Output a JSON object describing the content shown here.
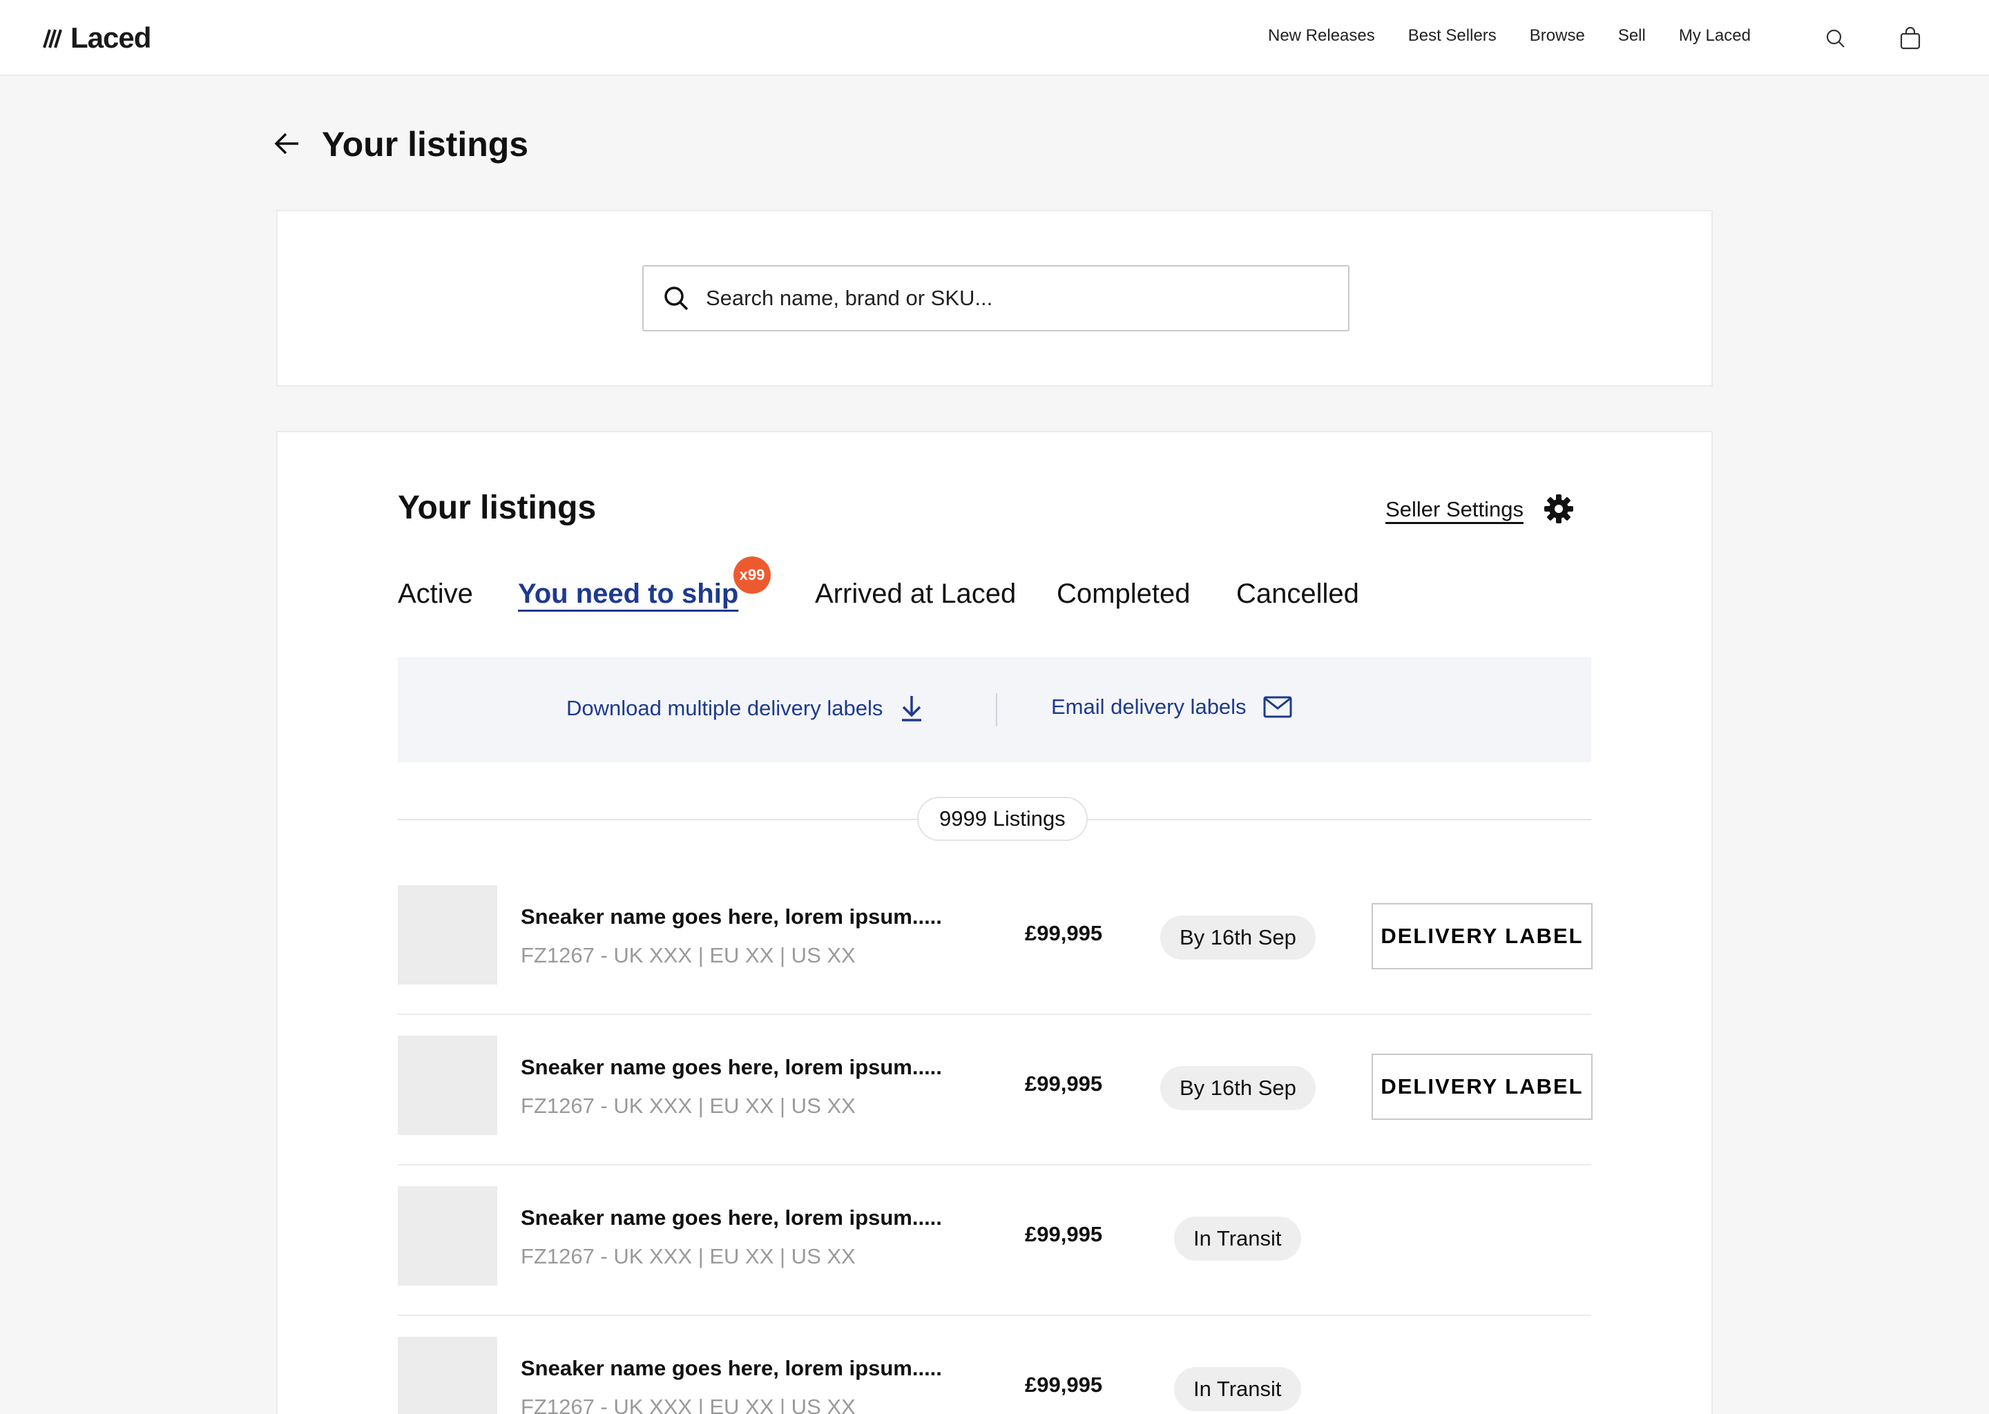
{
  "header": {
    "logo_text": "Laced",
    "nav": [
      "New Releases",
      "Best Sellers",
      "Browse",
      "Sell",
      "My Laced"
    ],
    "icons": [
      "search-icon",
      "bag-icon"
    ]
  },
  "page": {
    "title": "Your listings",
    "back_icon": "arrow-left-icon"
  },
  "search": {
    "placeholder": "Search name, brand or SKU..."
  },
  "listings": {
    "title": "Your listings",
    "seller_settings": "Seller Settings",
    "tabs": [
      "Active",
      "You need to ship",
      "Arrived at Laced",
      "Completed",
      "Cancelled"
    ],
    "active_tab": "You need to ship",
    "badge": "x99",
    "actions": {
      "download": "Download multiple delivery labels",
      "email": "Email delivery labels"
    },
    "count": "9999 Listings",
    "rows": [
      {
        "name": "Sneaker name goes here, lorem ipsum.....",
        "sku": "FZ1267 - UK XXX | EU XX | US XX",
        "price": "£99,995",
        "status": "By 16th Sep",
        "button": "DELIVERY LABEL"
      },
      {
        "name": "Sneaker name goes here, lorem ipsum.....",
        "sku": "FZ1267 - UK XXX | EU XX | US XX",
        "price": "£99,995",
        "status": "By 16th Sep",
        "button": "DELIVERY LABEL"
      },
      {
        "name": "Sneaker name goes here, lorem ipsum.....",
        "sku": "FZ1267 - UK XXX | EU XX | US XX",
        "price": "£99,995",
        "status": "In Transit"
      },
      {
        "name": "Sneaker name goes here, lorem ipsum.....",
        "sku": "FZ1267 - UK XXX | EU XX | US XX",
        "price": "£99,995",
        "status": "In Transit"
      }
    ]
  },
  "colors": {
    "accent": "#1d3a8f",
    "badge": "#ee5a2f",
    "background": "#f6f6f6"
  }
}
